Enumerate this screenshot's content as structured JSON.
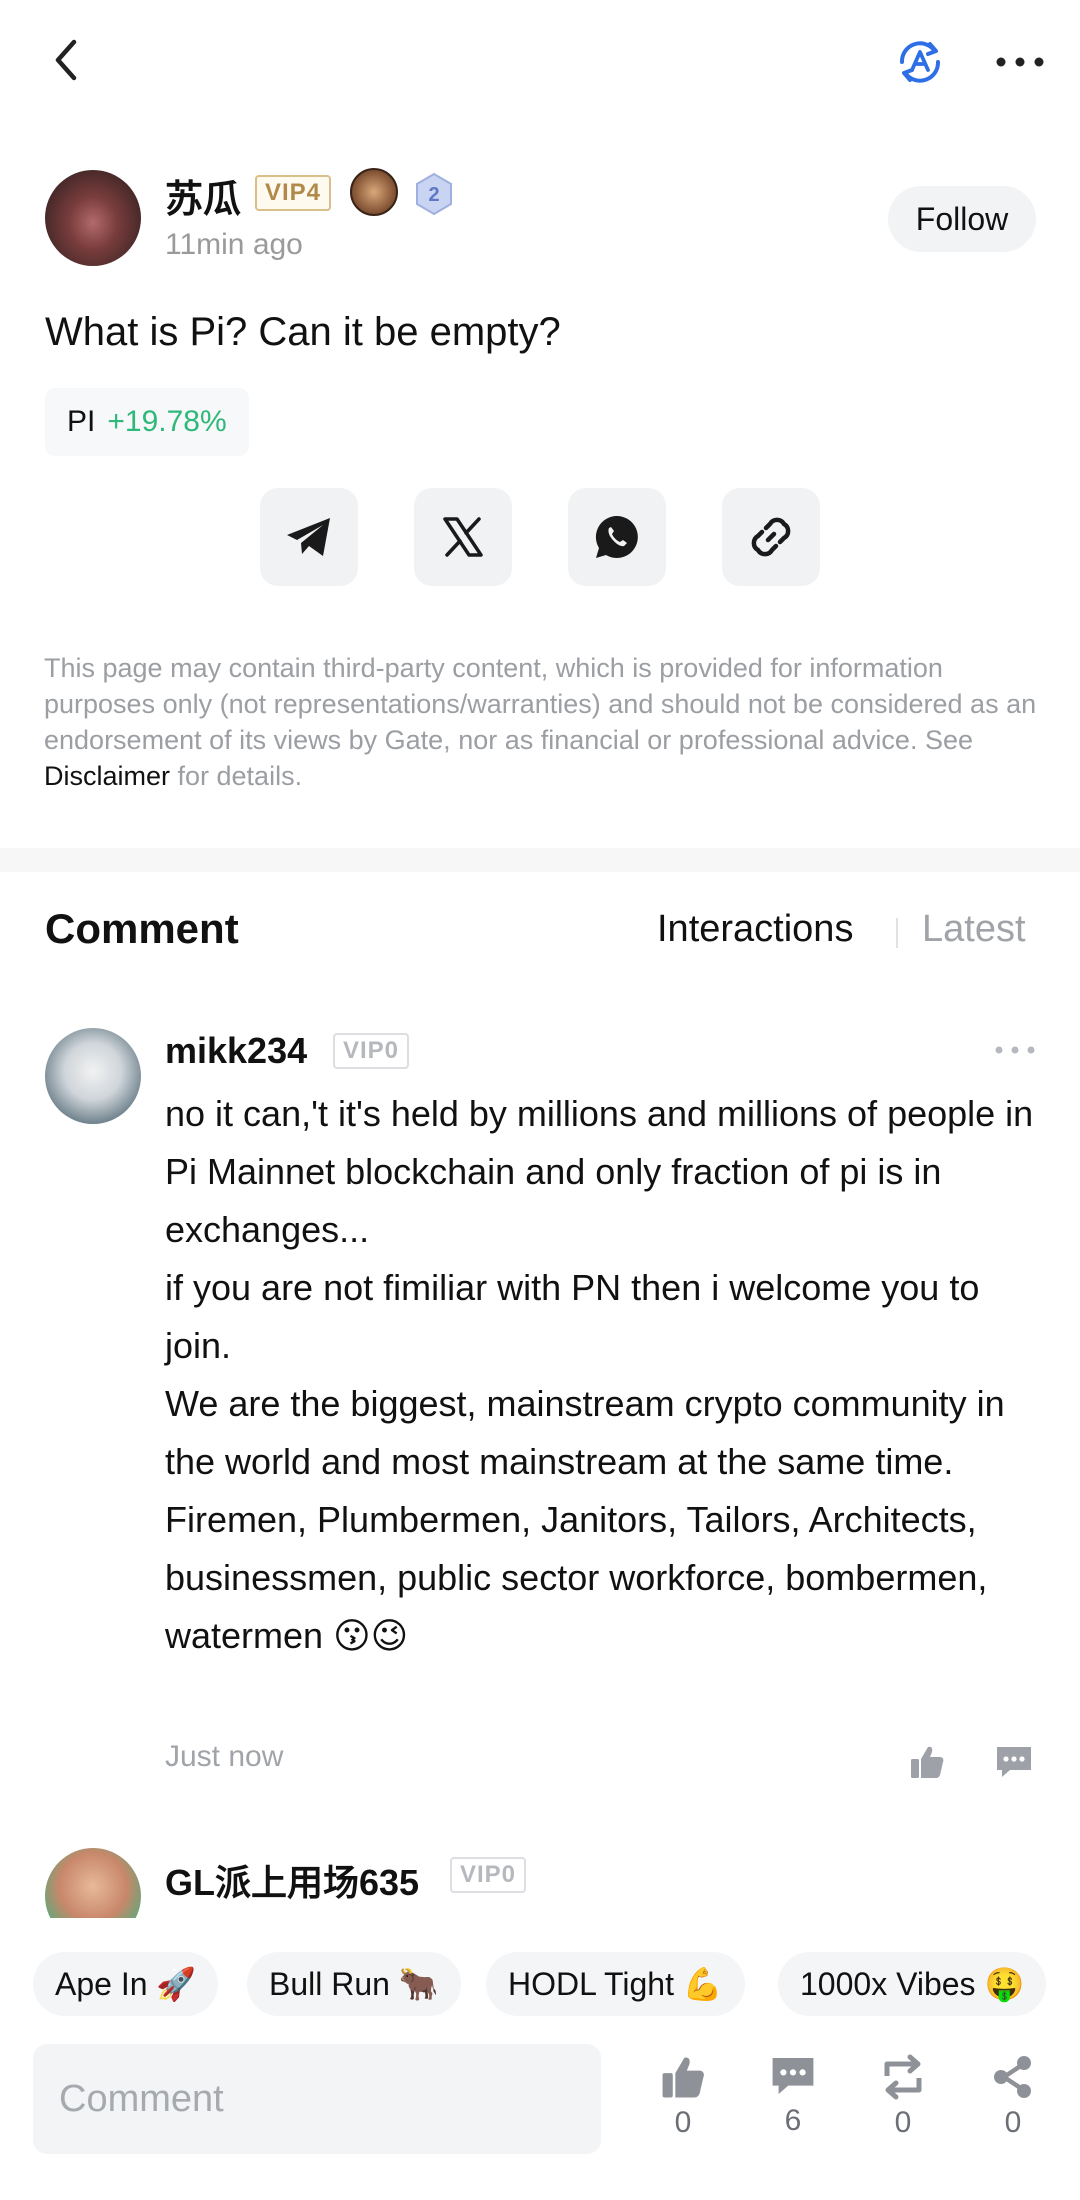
{
  "post": {
    "author": {
      "name": "苏瓜",
      "vip": "VIP4",
      "level": "2"
    },
    "time": "11min ago",
    "follow_label": "Follow",
    "text": "What is Pi? Can it be empty?",
    "coin": {
      "symbol": "PI",
      "change": "+19.78%"
    }
  },
  "share_icons": [
    "telegram-icon",
    "x-icon",
    "whatsapp-icon",
    "link-icon"
  ],
  "disclaimer": {
    "text_before": "This page may contain third-party content, which is provided for information purposes only (not representations/warranties) and should not be considered as an endorsement of its views by Gate, nor as financial or professional advice. See ",
    "link": "Disclaimer",
    "text_after": " for details."
  },
  "comments_header": {
    "title": "Comment",
    "sort_interactions": "Interactions",
    "sort_latest": "Latest"
  },
  "comments": [
    {
      "user": "mikk234",
      "vip": "VIP0",
      "lines": [
        "no it can,'t it's held by millions and millions of people in Pi Mainnet blockchain and only fraction of pi is in exchanges...",
        "if you are not fimiliar with PN then i welcome you to join.",
        "We are the biggest, mainstream crypto community in the world and most mainstream at the same time.",
        "Firemen, Plumbermen, Janitors, Tailors, Architects, businessmen, public sector workforce, bombermen, watermen 😗😉"
      ],
      "time": "Just now"
    },
    {
      "user": "GL派上用场635",
      "vip": "VIP0"
    }
  ],
  "reaction_chips": [
    "Ape In 🚀",
    "Bull Run 🐂",
    "HODL Tight 💪",
    "1000x Vibes 🤑"
  ],
  "bottom_bar": {
    "comment_placeholder": "Comment",
    "actions": [
      {
        "icon": "like-icon",
        "count": "0"
      },
      {
        "icon": "comment-icon",
        "count": "6"
      },
      {
        "icon": "repost-icon",
        "count": "0"
      },
      {
        "icon": "share-icon",
        "count": "0"
      }
    ]
  },
  "colors": {
    "positive": "#2fb87a",
    "accent_blue": "#2f6fe6",
    "vip4_gold": "#b08a4a"
  }
}
